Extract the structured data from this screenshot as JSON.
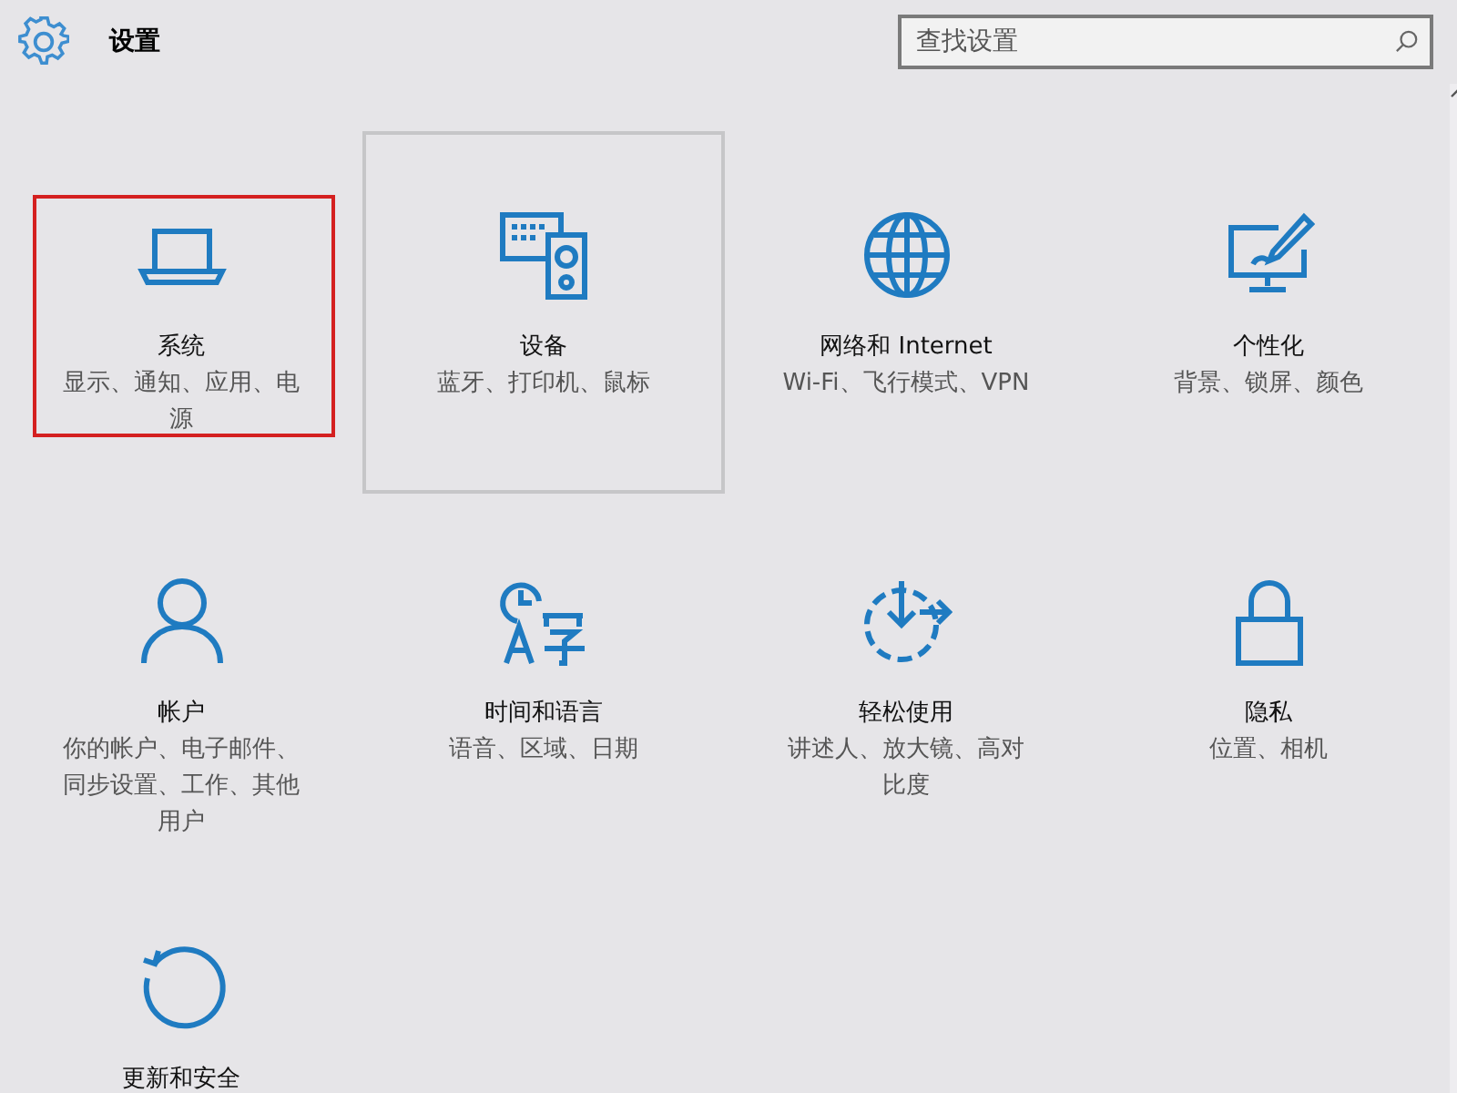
{
  "header": {
    "title": "设置"
  },
  "search": {
    "placeholder": "查找设置"
  },
  "tiles": [
    {
      "title": "系统",
      "subtitle": "显示、通知、应用、电源",
      "marked": true,
      "hovered": false
    },
    {
      "title": "设备",
      "subtitle": "蓝牙、打印机、鼠标",
      "marked": false,
      "hovered": true
    },
    {
      "title": "网络和 Internet",
      "subtitle": "Wi-Fi、飞行模式、VPN",
      "marked": false,
      "hovered": false
    },
    {
      "title": "个性化",
      "subtitle": "背景、锁屏、颜色",
      "marked": false,
      "hovered": false
    },
    {
      "title": "帐户",
      "subtitle": "你的帐户、电子邮件、同步设置、工作、其他用户",
      "marked": false,
      "hovered": false
    },
    {
      "title": "时间和语言",
      "subtitle": "语音、区域、日期",
      "marked": false,
      "hovered": false
    },
    {
      "title": "轻松使用",
      "subtitle": "讲述人、放大镜、高对比度",
      "marked": false,
      "hovered": false
    },
    {
      "title": "隐私",
      "subtitle": "位置、相机",
      "marked": false,
      "hovered": false
    },
    {
      "title": "更新和安全",
      "marked": false,
      "hovered": false
    }
  ]
}
